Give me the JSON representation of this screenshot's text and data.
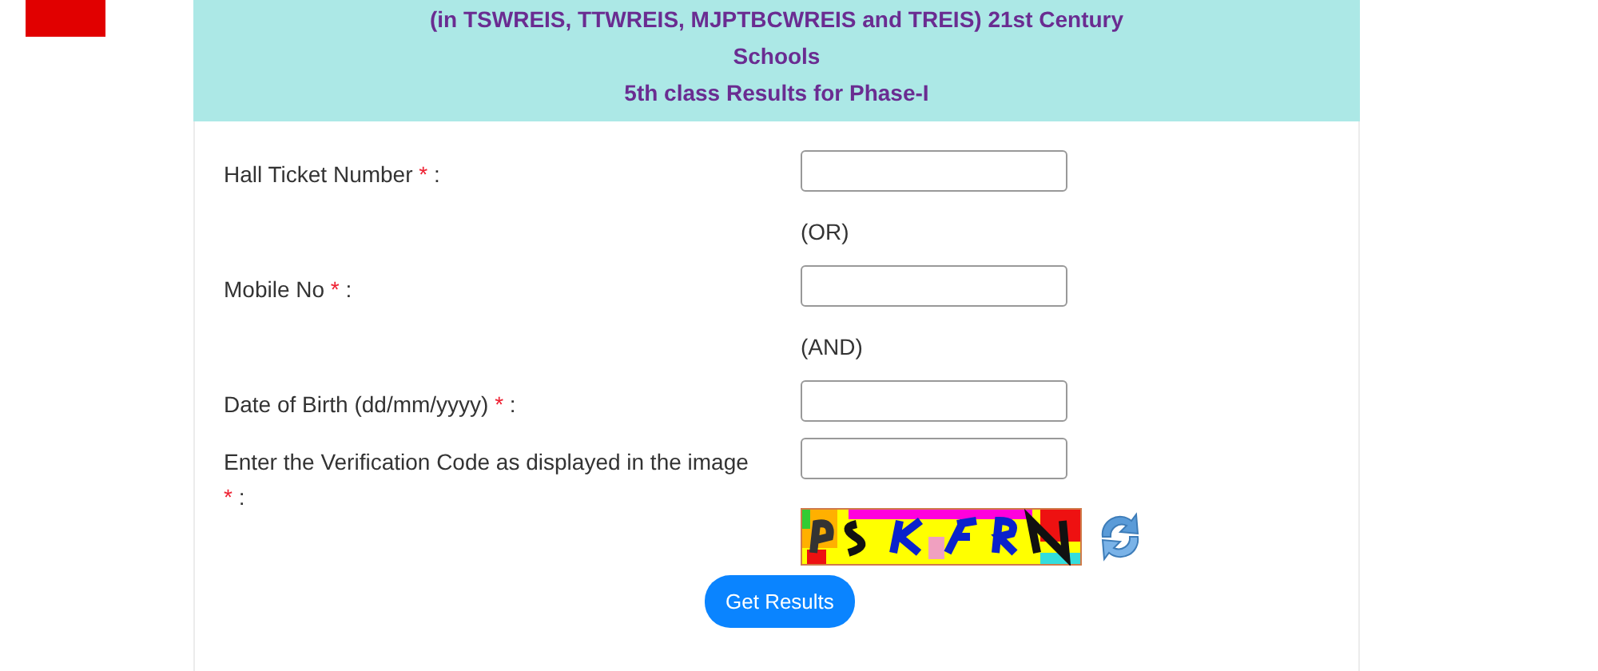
{
  "header": {
    "lines": [
      "(in TSWREIS, TTWREIS, MJPTBCWREIS and TREIS) 21st Century",
      "Schools",
      "5th class Results for Phase-I"
    ]
  },
  "form": {
    "items": [
      {
        "kind": "field",
        "label": "Hall Ticket Number",
        "mark": "*",
        "colon": ":"
      },
      {
        "kind": "separator",
        "text": "(OR)"
      },
      {
        "kind": "field",
        "label": "Mobile No",
        "mark": "*",
        "colon": ":"
      },
      {
        "kind": "separator",
        "text": "(AND)"
      },
      {
        "kind": "field",
        "label": "Date of Birth (dd/mm/yyyy)",
        "mark": "*",
        "colon": ":"
      },
      {
        "kind": "field",
        "label": "Enter the Verification Code as displayed in the image",
        "mark": "*",
        "colon": ":"
      }
    ],
    "submit": "Get Results"
  }
}
